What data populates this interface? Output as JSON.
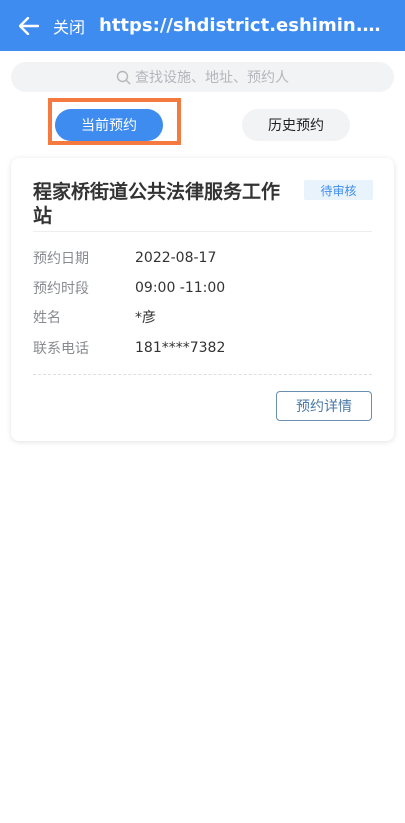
{
  "header": {
    "close_label": "关闭",
    "url": "https://shdistrict.eshimin.com/..."
  },
  "search": {
    "placeholder": "查找设施、地址、预约人"
  },
  "tabs": {
    "current": "当前预约",
    "history": "历史预约"
  },
  "card": {
    "title": "程家桥街道公共法律服务工作站",
    "status": "待审核",
    "rows": [
      {
        "label": "预约日期",
        "value": "2022-08-17"
      },
      {
        "label": "预约时段",
        "value": "09:00 -11:00"
      },
      {
        "label": "姓名",
        "value": "*彦"
      },
      {
        "label": "联系电话",
        "value": "181****7382"
      }
    ],
    "detail_button": "预约详情"
  },
  "colors": {
    "primary": "#3f8cf0",
    "highlight_outline": "#f47a3f",
    "badge_bg": "#e8f3fb"
  }
}
